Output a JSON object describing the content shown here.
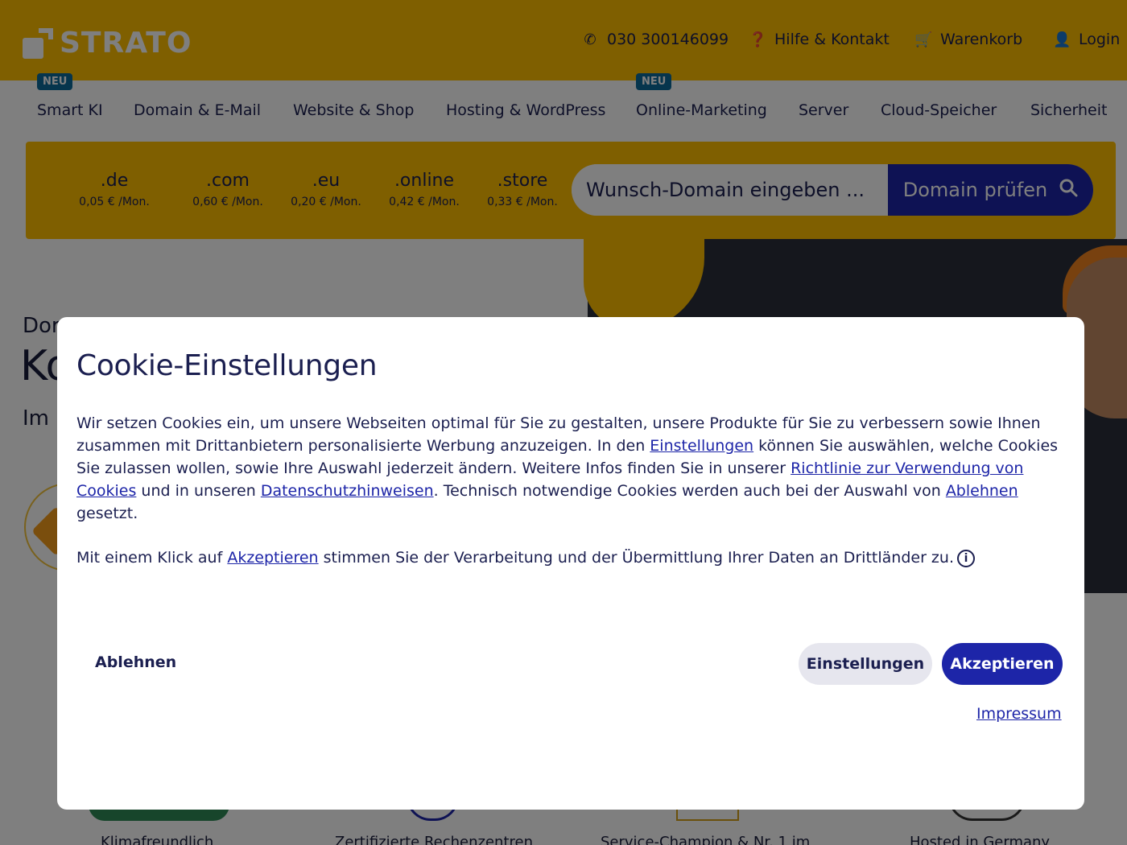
{
  "header": {
    "logo_text": "STRATO",
    "phone": "030 300146099",
    "help": "Hilfe & Kontakt",
    "cart": "Warenkorb",
    "login": "Login",
    "brand_color": "#ffbe00"
  },
  "nav": {
    "badge": "NEU",
    "items": [
      {
        "label": "Smart KI"
      },
      {
        "label": "Domain & E-Mail"
      },
      {
        "label": "Website & Shop"
      },
      {
        "label": "Hosting & WordPress"
      },
      {
        "label": "Online-Marketing"
      },
      {
        "label": "Server"
      },
      {
        "label": "Cloud-Speicher"
      },
      {
        "label": "Sicherheit"
      }
    ]
  },
  "domain_bar": {
    "tlds": [
      {
        "name": ".de",
        "price": "0,05 € /Mon."
      },
      {
        "name": ".com",
        "price": "0,60 € /Mon."
      },
      {
        "name": ".eu",
        "price": "0,20 € /Mon."
      },
      {
        "name": ".online",
        "price": "0,42 € /Mon."
      },
      {
        "name": ".store",
        "price": "0,33 € /Mon."
      }
    ],
    "search_placeholder": "Wunsch-Domain eingeben ...",
    "search_button": "Domain prüfen"
  },
  "hero": {
    "small": "Dor",
    "title": "Ko",
    "sub": "Im"
  },
  "trust": [
    {
      "label": "Klimafreundlich"
    },
    {
      "label": "Zertifizierte Rechenzentren"
    },
    {
      "label": "Service-Champion & Nr. 1 im"
    },
    {
      "label": "Hosted in Germany"
    }
  ],
  "cookie_modal": {
    "title": "Cookie-Einstellungen",
    "p1_a": "Wir setzen Cookies ein, um unsere Webseiten optimal für Sie zu gestalten, unsere Produkte für Sie zu verbessern sowie Ihnen zusammen mit Drittanbietern personalisierte Werbung anzuzeigen. In den ",
    "p1_link1": "Einstellungen",
    "p1_b": " können Sie auswählen, welche Cookies Sie zulassen wollen, sowie Ihre Auswahl jederzeit ändern. Weitere Infos finden Sie in unserer ",
    "p1_link2": "Richtlinie zur Verwendung von Cookies",
    "p1_c": " und in unseren ",
    "p1_link3": "Datenschutzhinweisen",
    "p1_d": ". Technisch notwendige Cookies werden auch bei der Auswahl von ",
    "p1_link4": "Ablehnen",
    "p1_e": " gesetzt.",
    "p2_a": "Mit einem Klick auf ",
    "p2_link": "Akzeptieren",
    "p2_b": " stimmen Sie der Verarbeitung und der Übermittlung Ihrer Daten an Drittländer zu.",
    "info_icon": "i",
    "reject_label": "Ablehnen",
    "settings_label": "Einstellungen",
    "accept_label": "Akzeptieren",
    "impressum_label": "Impressum",
    "accent_color": "#1d25a8"
  }
}
